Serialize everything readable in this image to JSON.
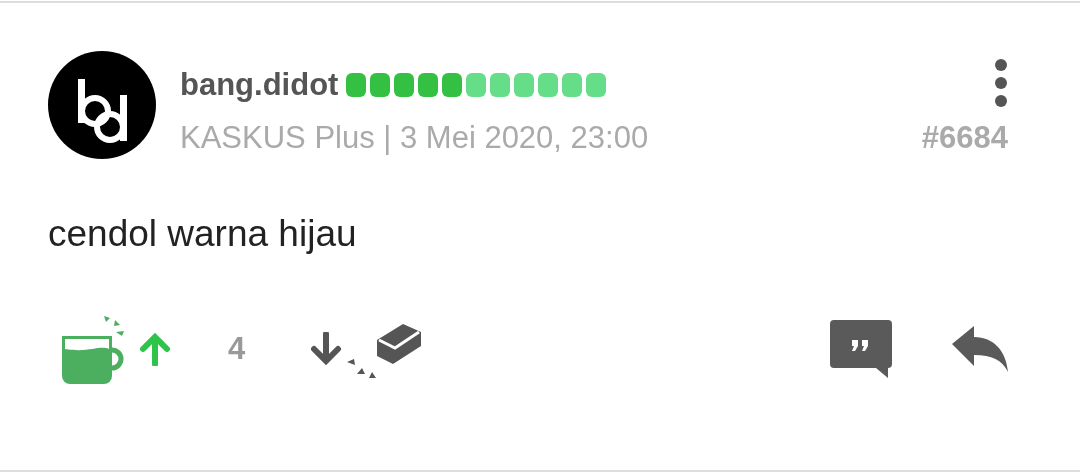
{
  "post": {
    "username": "bang.didot",
    "reputation": [
      {
        "color": "#33c043"
      },
      {
        "color": "#33c043"
      },
      {
        "color": "#33c043"
      },
      {
        "color": "#33c043"
      },
      {
        "color": "#33c043"
      },
      {
        "color": "#66dd88"
      },
      {
        "color": "#66dd88"
      },
      {
        "color": "#66dd88"
      },
      {
        "color": "#66dd88"
      },
      {
        "color": "#66dd88"
      },
      {
        "color": "#66dd88"
      }
    ],
    "meta": "KASKUS Plus | 3 Mei 2020, 23:00",
    "post_number": "#6684",
    "body": "cendol warna hijau",
    "vote_count": "4"
  }
}
